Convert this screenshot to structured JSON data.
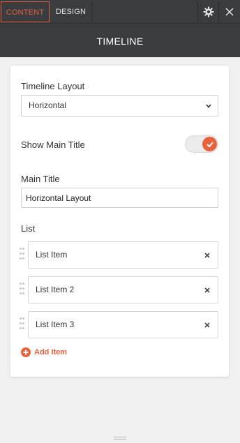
{
  "colors": {
    "accent": "#e8603c",
    "topbar": "#3a3d40",
    "background": "#f0f0f0"
  },
  "tabs": [
    {
      "label": "CONTENT",
      "active": true
    },
    {
      "label": "DESIGN",
      "active": false
    }
  ],
  "toolbar": {
    "settings_icon": "gear-icon",
    "close_icon": "close-icon"
  },
  "header": {
    "title": "TIMELINE"
  },
  "form": {
    "layout": {
      "label": "Timeline Layout",
      "selected": "Horizontal"
    },
    "show_main_title": {
      "label": "Show Main Title",
      "enabled": true
    },
    "main_title": {
      "label": "Main Title",
      "value": "Horizontal Layout"
    },
    "list": {
      "label": "List",
      "items": [
        {
          "label": "List Item"
        },
        {
          "label": "List Item 2"
        },
        {
          "label": "List Item 3"
        }
      ],
      "add_label": "Add Item"
    }
  }
}
